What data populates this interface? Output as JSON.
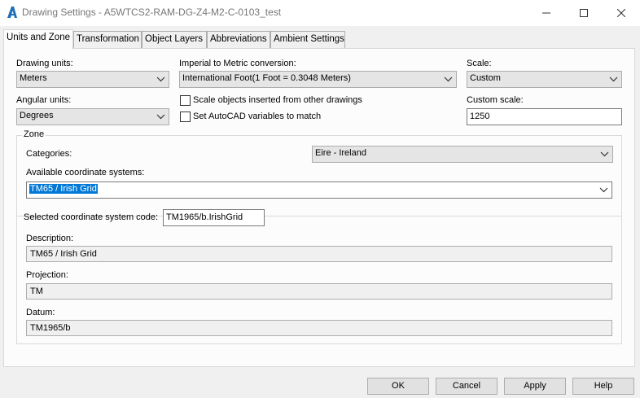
{
  "window": {
    "title": "Drawing Settings - A5WTCS2-RAM-DG-Z4-M2-C-0103_test"
  },
  "icons": {
    "app": "autocad-a-icon",
    "minimize": "minimize-icon",
    "maximize": "maximize-icon",
    "close": "close-icon",
    "dropdown": "chevron-down-icon"
  },
  "tabs": [
    {
      "label": "Units and Zone",
      "active": true
    },
    {
      "label": "Transformation"
    },
    {
      "label": "Object Layers"
    },
    {
      "label": "Abbreviations"
    },
    {
      "label": "Ambient Settings"
    }
  ],
  "units": {
    "drawing_units_label": "Drawing units:",
    "drawing_units_value": "Meters",
    "angular_units_label": "Angular units:",
    "angular_units_value": "Degrees",
    "conversion_label": "Imperial to Metric conversion:",
    "conversion_value": "International Foot(1 Foot = 0.3048 Meters)",
    "scale_objects_label": "Scale objects inserted from other drawings",
    "set_vars_label": "Set AutoCAD variables to match",
    "scale_label": "Scale:",
    "scale_value": "Custom",
    "custom_scale_label": "Custom scale:",
    "custom_scale_value": "1250"
  },
  "zone": {
    "legend": "Zone",
    "categories_label": "Categories:",
    "categories_value": "Eire - Ireland",
    "available_label": "Available coordinate systems:",
    "available_value": "TM65 / Irish Grid",
    "code_label": "Selected coordinate system code:",
    "code_value": "TM1965/b.IrishGrid",
    "description_label": "Description:",
    "description_value": "TM65 / Irish Grid",
    "projection_label": "Projection:",
    "projection_value": "TM",
    "datum_label": "Datum:",
    "datum_value": "TM1965/b"
  },
  "buttons": {
    "ok": "OK",
    "cancel": "Cancel",
    "apply": "Apply",
    "help": "Help"
  }
}
